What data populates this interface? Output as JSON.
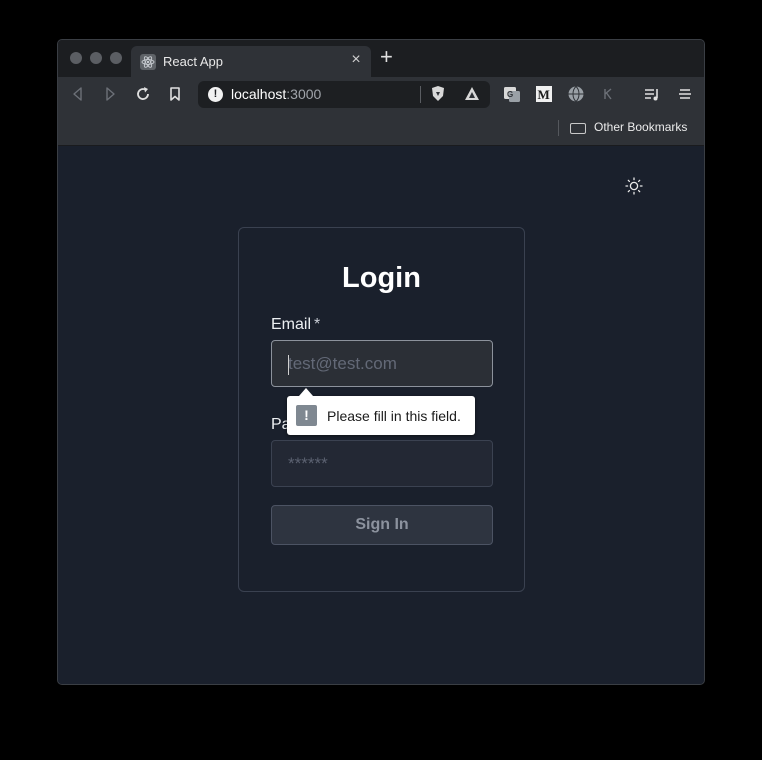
{
  "browser": {
    "tab": {
      "title": "React App",
      "close_glyph": "×",
      "favicon": "react-favicon-icon"
    },
    "new_tab_glyph": "+",
    "url": {
      "host": "localhost",
      "port": ":3000"
    },
    "bookmarks": {
      "other_label": "Other Bookmarks"
    }
  },
  "login": {
    "title": "Login",
    "email": {
      "label": "Email",
      "required_mark": "*",
      "placeholder": "test@test.com"
    },
    "password": {
      "label": "Pa",
      "placeholder": "******"
    },
    "submit_label": "Sign In"
  },
  "validation": {
    "message": "Please fill in this field.",
    "icon_glyph": "!"
  },
  "colors": {
    "page_bg": "#1a202c",
    "card_border": "#3a4150",
    "chrome_toolbar": "#2f3237"
  }
}
